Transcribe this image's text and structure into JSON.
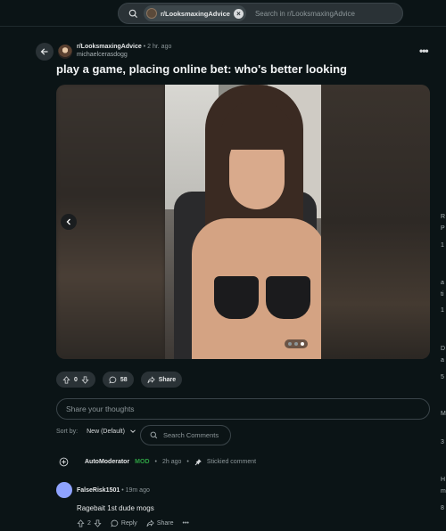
{
  "search": {
    "community_chip": "r/LooksmaxingAdvice",
    "placeholder": "Search in r/LooksmaxingAdvice"
  },
  "post": {
    "subreddit": "r/LooksmaxingAdvice",
    "age": "2 hr. ago",
    "author": "michaelcerasdogg",
    "title": "play a game, placing online bet: who's better looking",
    "gallery_total": 3,
    "gallery_current": 3
  },
  "actions": {
    "votes": "0",
    "comments": "58",
    "share": "Share"
  },
  "composer": {
    "placeholder": "Share your thoughts"
  },
  "sort": {
    "label": "Sort by:",
    "value": "New (Default)",
    "search_placeholder": "Search Comments"
  },
  "automod": {
    "name": "AutoModerator",
    "badge": "MOD",
    "age": "2h ago",
    "note": "Stickied comment"
  },
  "comments": [
    {
      "author": "FalseRisk1501",
      "age": "19m ago",
      "text": "Ragebait 1st dude mogs",
      "votes": "2",
      "reply": "Reply",
      "share": "Share"
    }
  ],
  "sidebar_fragments": [
    "R",
    "P",
    "1",
    "a",
    "ti",
    "1",
    "D",
    "a",
    "5",
    "M",
    "3",
    "H",
    "m",
    "8"
  ],
  "colors": {
    "background": "#0b1416",
    "accent_mod": "#2ea043",
    "avatar_blue": "#8fa3ff"
  }
}
